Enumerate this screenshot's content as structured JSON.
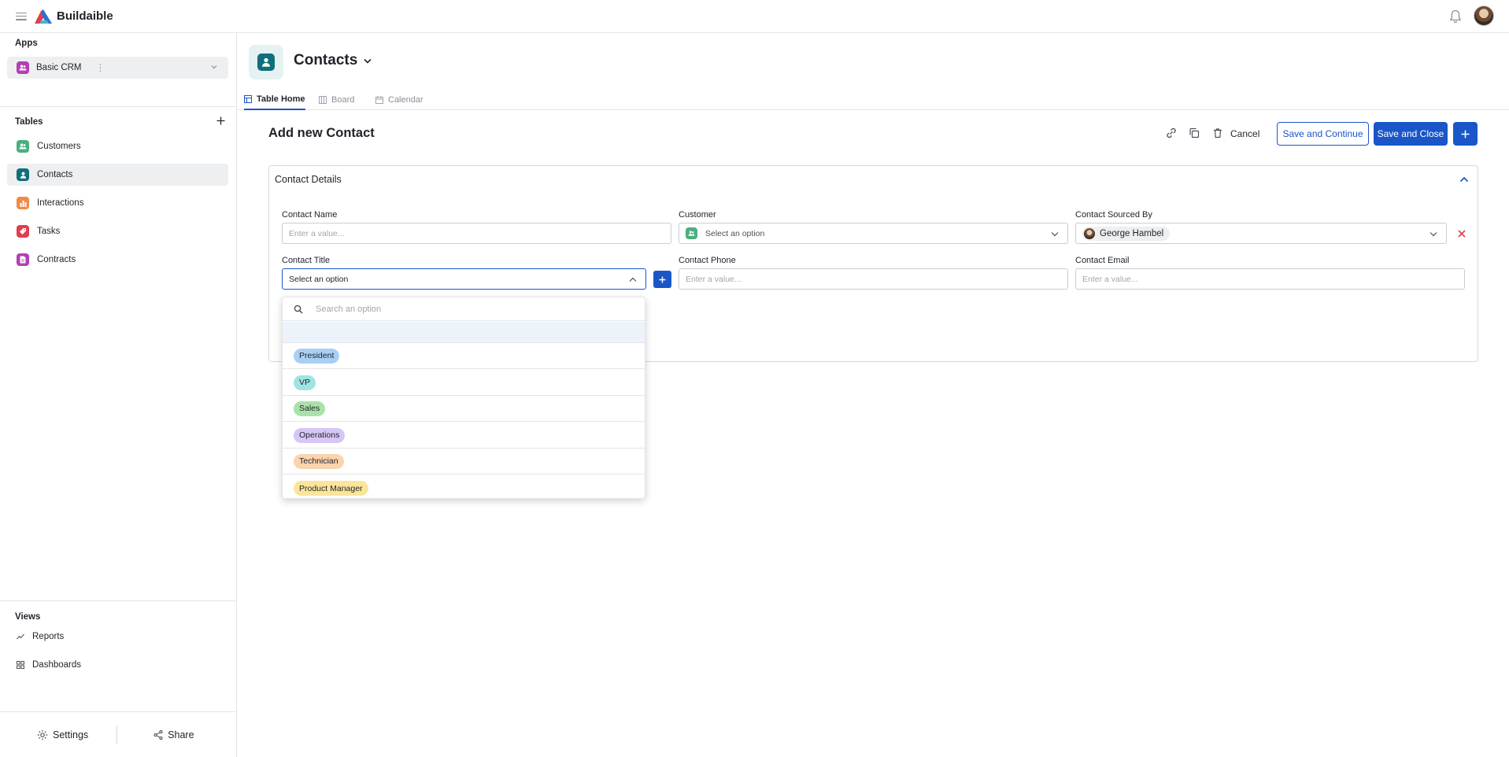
{
  "app": {
    "name": "Buildaible"
  },
  "sidebar": {
    "apps_title": "Apps",
    "current_app": "Basic CRM",
    "tables_title": "Tables",
    "tables": [
      {
        "label": "Customers",
        "color": "#4caf7d"
      },
      {
        "label": "Contacts",
        "color": "#0f6f7a"
      },
      {
        "label": "Interactions",
        "color": "#f08a4b"
      },
      {
        "label": "Tasks",
        "color": "#e03e4f"
      },
      {
        "label": "Contracts",
        "color": "#b23fb6"
      }
    ],
    "views_title": "Views",
    "views": [
      {
        "label": "Reports",
        "icon": "chart-line-icon"
      },
      {
        "label": "Dashboards",
        "icon": "grid-icon"
      }
    ],
    "footer": {
      "settings": "Settings",
      "share": "Share"
    }
  },
  "page": {
    "title": "Contacts",
    "tabs": [
      {
        "label": "Table Home",
        "active": true
      },
      {
        "label": "Board",
        "active": false
      },
      {
        "label": "Calendar",
        "active": false
      }
    ]
  },
  "form": {
    "title": "Add new Contact",
    "actions": {
      "cancel": "Cancel",
      "save_continue": "Save and Continue",
      "save_close": "Save and Close"
    },
    "section_title": "Contact Details",
    "fields": {
      "contact_name": {
        "label": "Contact Name",
        "placeholder": "Enter a value..."
      },
      "customer": {
        "label": "Customer",
        "placeholder": "Select an option"
      },
      "sourced_by": {
        "label": "Contact Sourced By",
        "value": "George Hambel"
      },
      "contact_title": {
        "label": "Contact Title",
        "placeholder": "Select an option"
      },
      "contact_phone": {
        "label": "Contact Phone",
        "placeholder": "Enter a value..."
      },
      "contact_email": {
        "label": "Contact Email",
        "placeholder": "Enter a value..."
      }
    },
    "title_dropdown": {
      "search_placeholder": "Search an option",
      "options": [
        {
          "label": "President",
          "color": "#a8d0f5"
        },
        {
          "label": "VP",
          "color": "#9fe3e3"
        },
        {
          "label": "Sales",
          "color": "#a9e2a8"
        },
        {
          "label": "Operations",
          "color": "#d6c6f5"
        },
        {
          "label": "Technician",
          "color": "#fbd3ad"
        },
        {
          "label": "Product Manager",
          "color": "#fbe59a"
        }
      ]
    }
  },
  "colors": {
    "accent": "#1a56c8",
    "danger": "#e03e4f"
  }
}
